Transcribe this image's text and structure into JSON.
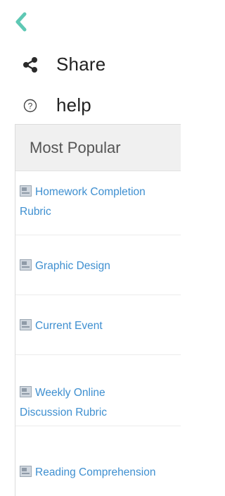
{
  "colors": {
    "accent_teal": "#5ec8b4",
    "share_icon": "#2b2b2b",
    "link_blue": "#3e8fd0",
    "header_bg": "#f0f0f0"
  },
  "toolbar": {
    "back_icon": "chevron-left-icon",
    "share": {
      "icon": "share-icon",
      "label": "Share"
    },
    "help": {
      "icon": "question-circle-icon",
      "label": "help"
    }
  },
  "popular": {
    "title": "Most Popular",
    "items": [
      {
        "label": "Homework Completion Rubric"
      },
      {
        "label": "Graphic Design"
      },
      {
        "label": "Current Event"
      },
      {
        "label": "Weekly Online Discussion Rubric"
      },
      {
        "label": "Reading Comprehension"
      }
    ]
  }
}
